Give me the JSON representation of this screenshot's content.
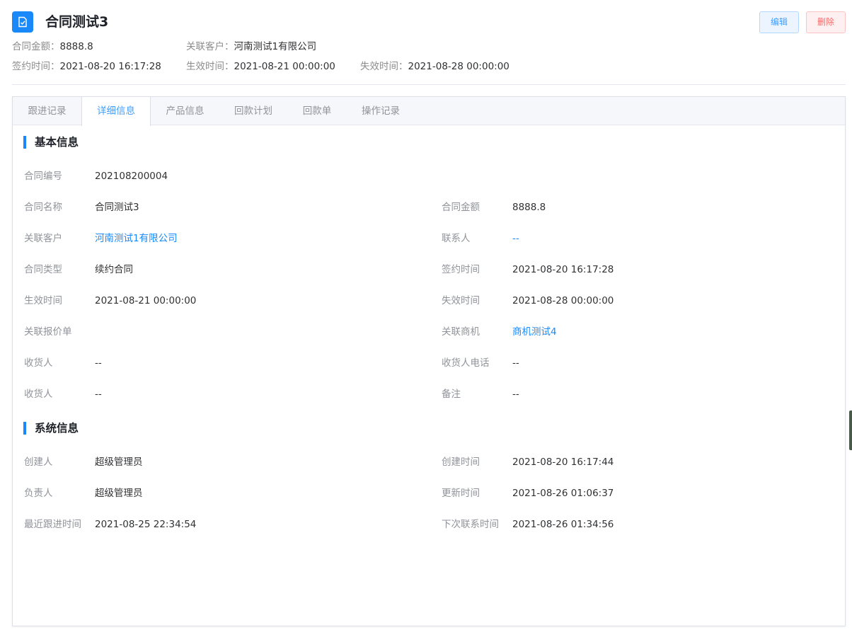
{
  "header": {
    "title": "合同测试3",
    "edit_label": "编辑",
    "delete_label": "删除"
  },
  "meta": {
    "amount_label": "合同金额：",
    "amount_value": "8888.8",
    "customer_label": "关联客户：",
    "customer_value": "河南测试1有限公司",
    "sign_label": "签约时间：",
    "sign_value": "2021-08-20 16:17:28",
    "effective_label": "生效时间：",
    "effective_value": "2021-08-21 00:00:00",
    "expire_label": "失效时间：",
    "expire_value": "2021-08-28 00:00:00"
  },
  "tabs": [
    {
      "label": "跟进记录"
    },
    {
      "label": "详细信息"
    },
    {
      "label": "产品信息"
    },
    {
      "label": "回款计划"
    },
    {
      "label": "回款单"
    },
    {
      "label": "操作记录"
    }
  ],
  "active_tab": "详细信息",
  "basic": {
    "title": "基本信息",
    "fields": [
      {
        "label": "合同编号",
        "value": "202108200004"
      },
      {
        "label": "合同名称",
        "value": "合同测试3"
      },
      {
        "label": "合同金额",
        "value": "8888.8"
      },
      {
        "label": "关联客户",
        "value": "河南测试1有限公司"
      },
      {
        "label": "联系人",
        "value": "--"
      },
      {
        "label": "合同类型",
        "value": "续约合同"
      },
      {
        "label": "签约时间",
        "value": "2021-08-20 16:17:28"
      },
      {
        "label": "生效时间",
        "value": "2021-08-21 00:00:00"
      },
      {
        "label": "失效时间",
        "value": "2021-08-28 00:00:00"
      },
      {
        "label": "关联报价单",
        "value": ""
      },
      {
        "label": "关联商机",
        "value": "商机测试4"
      },
      {
        "label": "收货人",
        "value": "--"
      },
      {
        "label": "收货人电话",
        "value": "--"
      },
      {
        "label": "收货人",
        "value": "--"
      },
      {
        "label": "备注",
        "value": "--"
      }
    ]
  },
  "system": {
    "title": "系统信息",
    "fields": [
      {
        "label": "创建人",
        "value": "超级管理员"
      },
      {
        "label": "创建时间",
        "value": "2021-08-20 16:17:44"
      },
      {
        "label": "负责人",
        "value": "超级管理员"
      },
      {
        "label": "更新时间",
        "value": "2021-08-26 01:06:37"
      },
      {
        "label": "最近跟进时间",
        "value": "2021-08-25 22:34:54"
      },
      {
        "label": "下次联系时间",
        "value": "2021-08-26 01:34:56"
      }
    ]
  },
  "colors": {
    "accent": "#1989fa",
    "link": "#1989fa",
    "danger": "#f56c6c"
  }
}
